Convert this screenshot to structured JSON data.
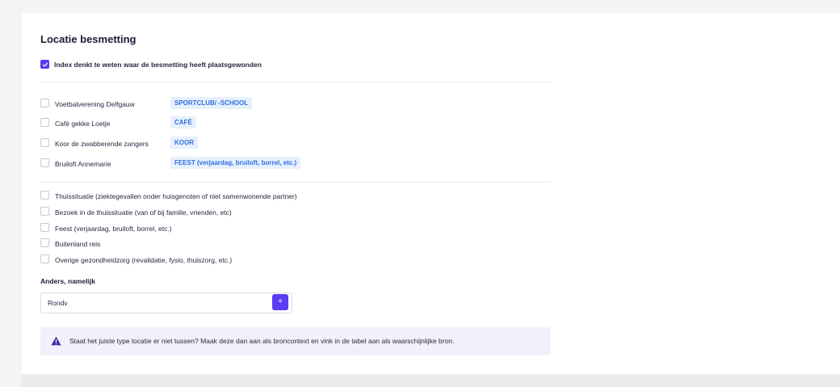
{
  "section": {
    "title": "Locatie besmetting",
    "index_checkbox_label": "Index denkt te weten waar de besmetting heeft plaatsgewonden",
    "index_checked": true
  },
  "known_locations": [
    {
      "name": "Voetbalverening Delfgauw",
      "tag": "SPORTCLUB/ -SCHOOL"
    },
    {
      "name": "Café gekke Loetje",
      "tag": "CAFÉ"
    },
    {
      "name": "Koor de zwabberende zangers",
      "tag": "KOOR"
    },
    {
      "name": "Bruiloft Annemarie",
      "tag": "FEEST (verjaardag, bruiloft, borrel, etc.)"
    }
  ],
  "location_types": [
    "Thuissituatie (ziektegevallen onder huisgenoten of niet samenwonende partner)",
    "Bezoek in de thuissituatie (van of bij familie, vrienden, etc)",
    "Feest (verjaardag, bruiloft, borrel, etc.)",
    "Buitenland reis",
    "Overige gezondheidzorg (revalidatie, fysio, thuiszorg, etc.)"
  ],
  "other": {
    "label": "Anders, namelijk",
    "value": "Rondv",
    "add_button": "+"
  },
  "notice": {
    "text": "Staat het juiste type locatie er niet tussen? Maak deze dan aan als broncontext en vink in de tabel aan als waarschijnlijke bron."
  },
  "colors": {
    "accent": "#5b3cf5",
    "tag_bg": "#e7f0fd",
    "tag_text": "#2f6fe0",
    "notice_bg": "#f2f0fb"
  }
}
